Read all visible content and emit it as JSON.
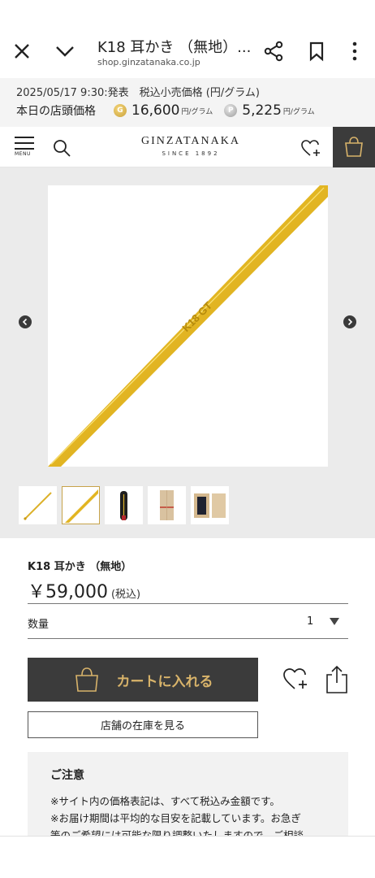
{
  "browser": {
    "title": "K18 耳かき （無地）...",
    "url": "shop.ginzatanaka.co.jp"
  },
  "price_banner": {
    "line1": "2025/05/17 9:30:発表　税込小売価格 (円/グラム)",
    "shop_label": "本日の店頭価格",
    "gold_badge": "G",
    "gold_price": "16,600",
    "gold_unit": "円/グラム",
    "platinum_badge": "P",
    "platinum_price": "5,225",
    "platinum_unit": "円/グラム"
  },
  "header": {
    "menu_label": "MENU",
    "logo_main": "GINZATANAKA",
    "logo_sub": "SINCE 1892"
  },
  "gallery": {
    "engraving": "K18 GT",
    "thumbnail_count": 5,
    "active_thumbnail": 2
  },
  "product": {
    "name": "K18 耳かき （無地）",
    "price": "￥59,000",
    "tax_note": "(税込)",
    "qty_label": "数量",
    "qty_value": "1"
  },
  "actions": {
    "add_to_cart": "カートに入れる",
    "store_stock": "店舗の在庫を見る"
  },
  "notice": {
    "title": "ご注意",
    "lines": [
      "※サイト内の価格表記は、すべて税込み金額です。",
      "※お届け期間は平均的な目安を記載しています。お急ぎ",
      "等のご希望には可能な限り調整いたしますので、ご相談"
    ]
  },
  "colors": {
    "accent_gold": "#d8b36a",
    "dark": "#3b3b3b",
    "gold_item": "#e6bf28"
  }
}
